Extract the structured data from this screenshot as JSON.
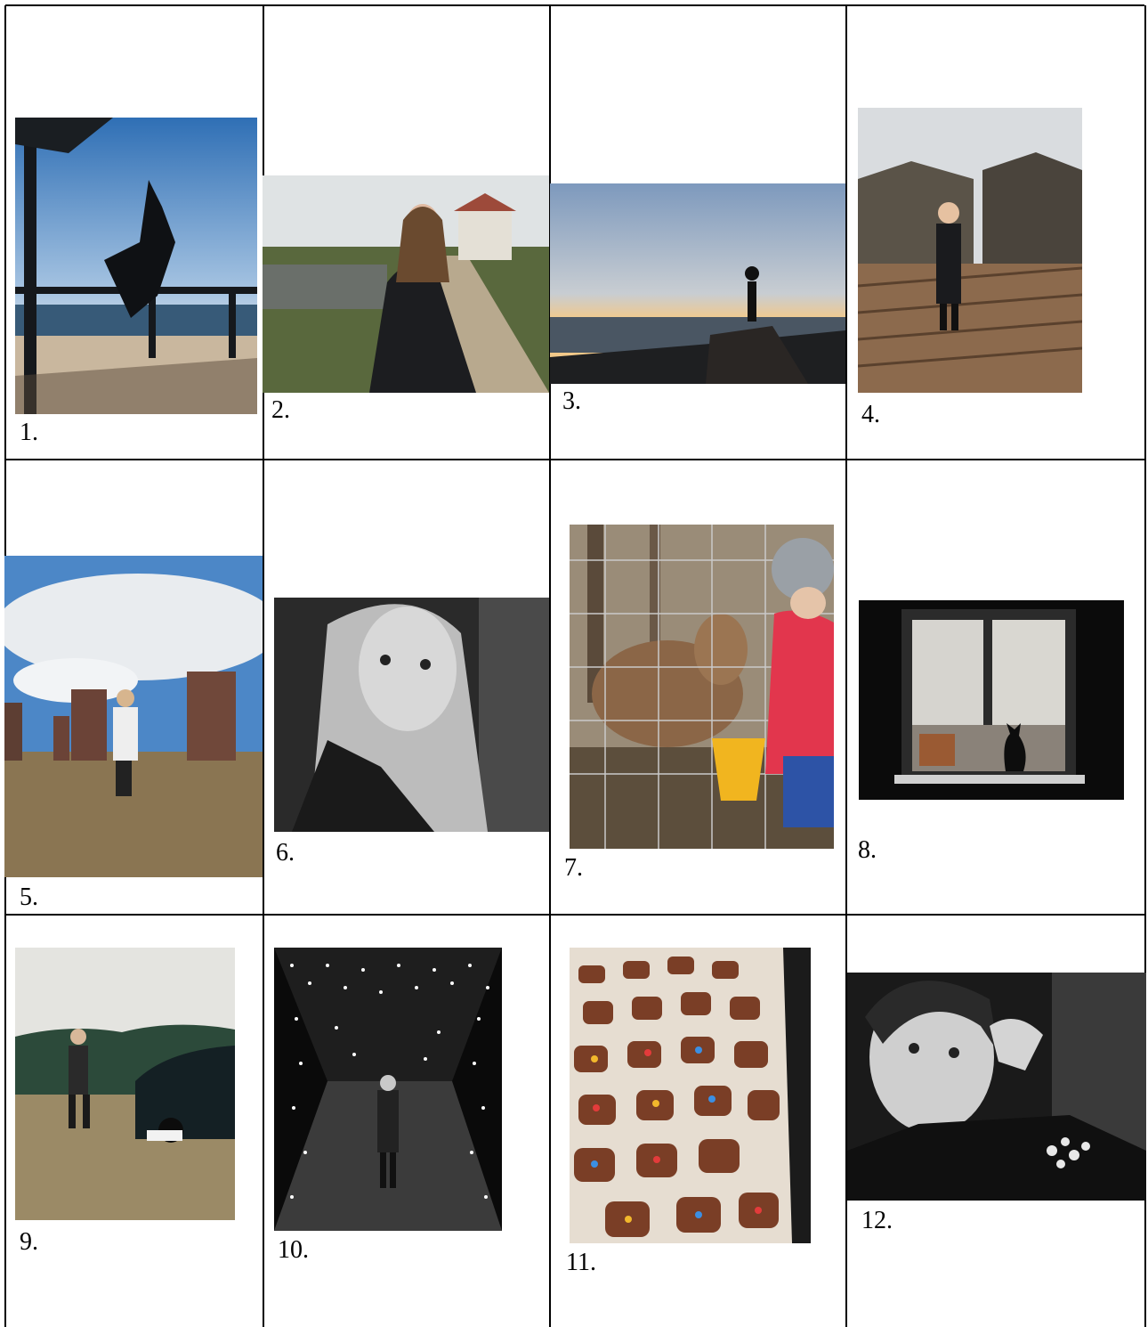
{
  "photos": [
    {
      "caption": "1.",
      "icon": "silhouette-jumping-on-pier-photo"
    },
    {
      "caption": "2.",
      "icon": "woman-on-village-road-photo"
    },
    {
      "caption": "3.",
      "icon": "silhouette-at-sea-sunset-photo"
    },
    {
      "caption": "4.",
      "icon": "woman-at-log-cabin-photo"
    },
    {
      "caption": "5.",
      "icon": "woman-near-brick-ruins-photo"
    },
    {
      "caption": "6.",
      "icon": "bw-selfie-portrait-photo"
    },
    {
      "caption": "7.",
      "icon": "feeding-deer-through-fence-photo"
    },
    {
      "caption": "8.",
      "icon": "cat-in-window-photo"
    },
    {
      "caption": "9.",
      "icon": "woman-with-car-photo"
    },
    {
      "caption": "10.",
      "icon": "light-tunnel-photo"
    },
    {
      "caption": "11.",
      "icon": "gingerbread-cookies-photo"
    },
    {
      "caption": "12.",
      "icon": "bw-portrait-with-flowers-photo"
    }
  ]
}
